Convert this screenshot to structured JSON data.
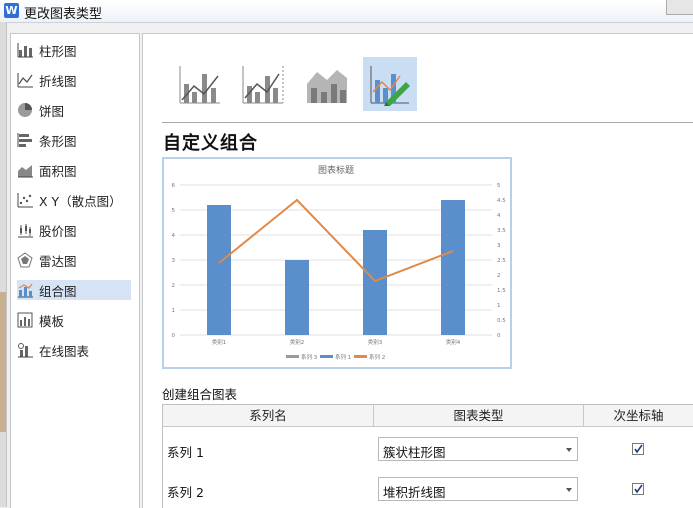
{
  "window": {
    "title": "更改图表类型",
    "app_icon_letter": "W"
  },
  "sidebar": {
    "items": [
      {
        "label": "柱形图",
        "icon": "column-chart-icon",
        "active": false
      },
      {
        "label": "折线图",
        "icon": "line-chart-icon",
        "active": false
      },
      {
        "label": "饼图",
        "icon": "pie-chart-icon",
        "active": false
      },
      {
        "label": "条形图",
        "icon": "bar-chart-icon",
        "active": false
      },
      {
        "label": "面积图",
        "icon": "area-chart-icon",
        "active": false
      },
      {
        "label": "X Y（散点图）",
        "icon": "scatter-chart-icon",
        "active": false
      },
      {
        "label": "股价图",
        "icon": "stock-chart-icon",
        "active": false
      },
      {
        "label": "雷达图",
        "icon": "radar-chart-icon",
        "active": false
      },
      {
        "label": "组合图",
        "icon": "combo-chart-icon",
        "active": true
      },
      {
        "label": "模板",
        "icon": "template-icon",
        "active": false
      },
      {
        "label": "在线图表",
        "icon": "online-chart-icon",
        "active": false
      }
    ]
  },
  "subtypes": [
    {
      "icon": "clustered-column-line-icon",
      "active": false
    },
    {
      "icon": "clustered-column-line-secondary-axis-icon",
      "active": false
    },
    {
      "icon": "stacked-area-clustered-column-icon",
      "active": false
    },
    {
      "icon": "custom-combination-icon",
      "active": true
    }
  ],
  "main": {
    "section_title": "自定义组合",
    "combo_label": "创建组合图表"
  },
  "preview": {
    "chart_data": {
      "type": "bar",
      "title": "图表标题",
      "categories": [
        "类别1",
        "类别2",
        "类别3",
        "类别4"
      ],
      "series": [
        {
          "name": "系列 1",
          "type": "bar",
          "axis": "primary",
          "values": [
            5.2,
            3.0,
            4.2,
            5.4
          ],
          "color": "#5b8fcb"
        },
        {
          "name": "系列 2",
          "type": "line",
          "axis": "secondary",
          "values": [
            2.4,
            4.5,
            1.8,
            2.8
          ],
          "color": "#e08a4a"
        }
      ],
      "legend_entries": [
        "系列 3",
        "系列 1",
        "系列 2"
      ],
      "legend_colors": [
        "#9a9a9a",
        "#5b8fcb",
        "#e08a4a"
      ],
      "legend_position": "bottom",
      "ylim": [
        0,
        6
      ],
      "yticks": [
        "0",
        "1",
        "2",
        "3",
        "4",
        "5",
        "6"
      ],
      "y2lim": [
        0,
        5
      ],
      "y2ticks": [
        "0",
        "0.5",
        "1",
        "1.5",
        "2",
        "2.5",
        "3",
        "3.5",
        "4",
        "4.5",
        "5"
      ],
      "grid": true
    }
  },
  "table": {
    "headers": [
      "系列名",
      "图表类型",
      "次坐标轴"
    ],
    "rows": [
      {
        "name": "系列 1",
        "type": "簇状柱形图",
        "secondary_axis": true
      },
      {
        "name": "系列 2",
        "type": "堆积折线图",
        "secondary_axis": true
      }
    ]
  },
  "colors": {
    "accent": "#5b8fcb",
    "line": "#e08a4a",
    "active_bg": "#d5e3f5"
  }
}
